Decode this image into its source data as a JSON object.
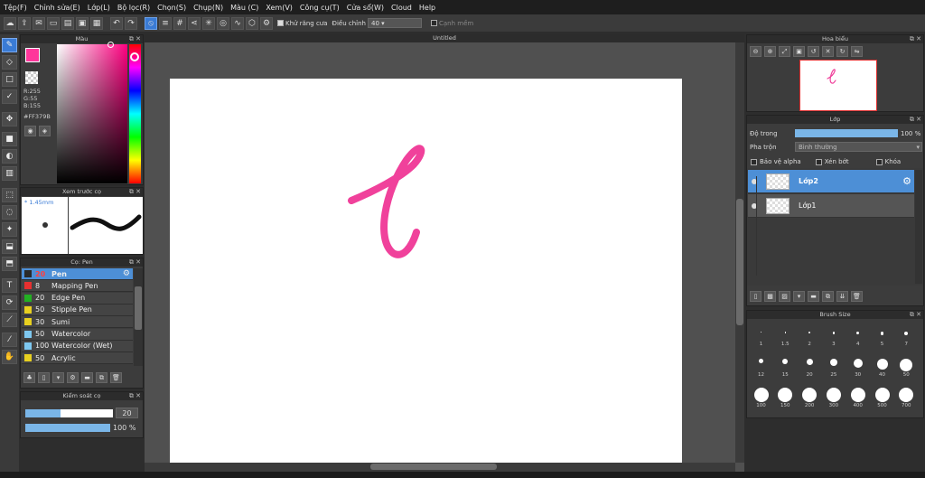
{
  "menu": [
    "Tệp(F)",
    "Chỉnh sửa(E)",
    "Lớp(L)",
    "Bộ lọc(R)",
    "Chọn(S)",
    "Chụp(N)",
    "Màu (C)",
    "Xem(V)",
    "Công cụ(T)",
    "Cửa sổ(W)",
    "Cloud",
    "Help"
  ],
  "toolbar": {
    "antialias_label": "Khử răng cưa",
    "correction_label": "Điều chỉnh",
    "correction_value": "40",
    "edge_label": "Cạnh mềm"
  },
  "color_panel": {
    "title": "Màu",
    "r": "R:255",
    "g": "G:55",
    "b": "B:155",
    "hex": "#FF379B",
    "fg_color": "#FF379B"
  },
  "preview_panel": {
    "title": "Xem trước cọ",
    "size": "1.45mm"
  },
  "brush_panel": {
    "title": "Cọ: Pen",
    "items": [
      {
        "size": "20",
        "name": "Pen",
        "color": "#2a2a2a"
      },
      {
        "size": "8",
        "name": "Mapping Pen",
        "color": "#e83030"
      },
      {
        "size": "20",
        "name": "Edge Pen",
        "color": "#22b022"
      },
      {
        "size": "50",
        "name": "Stipple Pen",
        "color": "#e8d020"
      },
      {
        "size": "30",
        "name": "Sumi",
        "color": "#e8d020"
      },
      {
        "size": "50",
        "name": "Watercolor",
        "color": "#7ec8f0"
      },
      {
        "size": "100",
        "name": "Watercolor (Wet)",
        "color": "#7ec8f0"
      },
      {
        "size": "50",
        "name": "Acrylic",
        "color": "#e8d020"
      }
    ]
  },
  "brush_control": {
    "title": "Kiểm soát cọ",
    "size_value": "20",
    "opacity_value": "100 %",
    "size_fraction": 0.4,
    "opacity_fraction": 1.0
  },
  "canvas": {
    "title": "Untitled",
    "stroke_color": "#F0419B"
  },
  "navigator": {
    "title": "Hoa biểu"
  },
  "layer_panel": {
    "title": "Lớp",
    "opacity_label": "Độ trong",
    "opacity_value": "100 %",
    "blend_label": "Pha trộn",
    "blend_value": "Bình thường",
    "protect_alpha": "Bảo vệ alpha",
    "clipping": "Xén bớt",
    "lock": "Khóa",
    "layers": [
      {
        "name": "Lớp2",
        "selected": true
      },
      {
        "name": "Lớp1",
        "selected": false
      }
    ]
  },
  "brush_size_panel": {
    "title": "Brush Size",
    "row1": [
      "1",
      "1.5",
      "2",
      "3",
      "4",
      "5",
      "7"
    ],
    "row2": [
      "12",
      "15",
      "20",
      "25",
      "30",
      "40",
      "50"
    ],
    "row3": [
      "100",
      "150",
      "200",
      "300",
      "400",
      "500",
      "700"
    ]
  },
  "colors": {
    "accent": "#4D8FD6",
    "bg": "#2D2D2D"
  }
}
